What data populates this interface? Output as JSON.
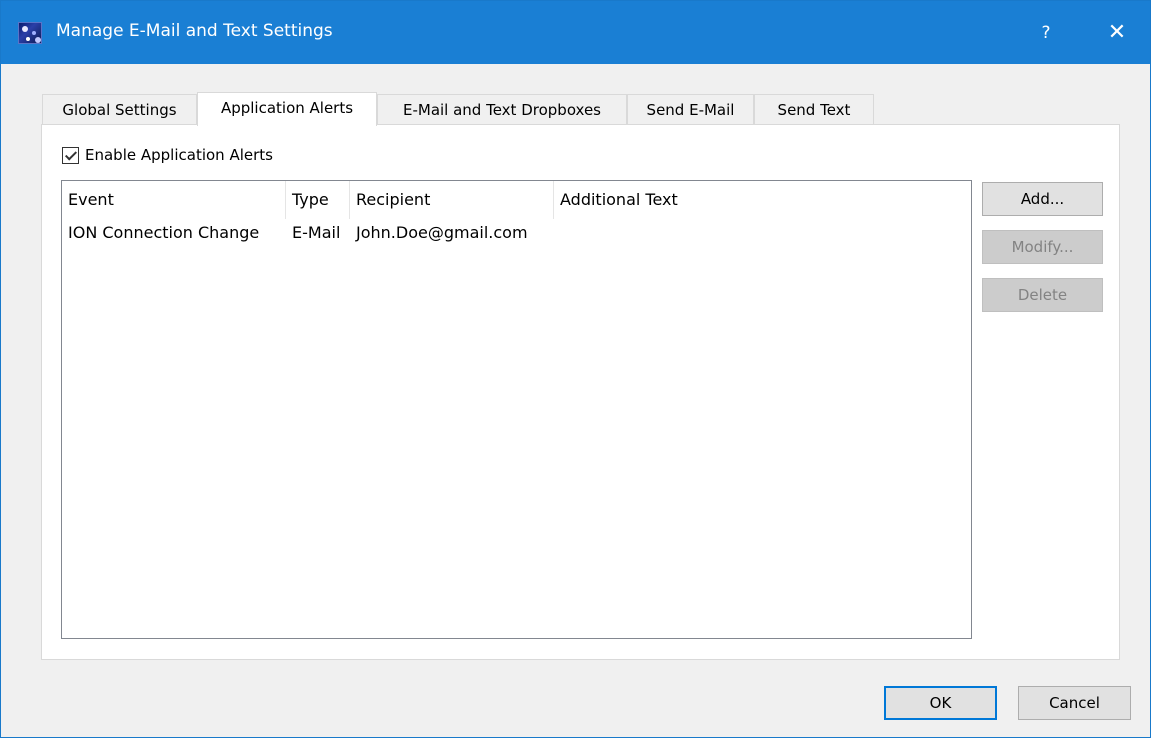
{
  "window": {
    "title": "Manage E-Mail and Text Settings",
    "help_glyph": "?",
    "close_glyph": "✕",
    "accent_color": "#1a7fd4",
    "app_icon": "app-logo-icon"
  },
  "tabs": [
    {
      "label": "Global Settings",
      "active": false
    },
    {
      "label": "Application Alerts",
      "active": true
    },
    {
      "label": "E-Mail and Text Dropboxes",
      "active": false
    },
    {
      "label": "Send E-Mail",
      "active": false
    },
    {
      "label": "Send Text",
      "active": false
    }
  ],
  "alerts": {
    "enable_label": "Enable Application Alerts",
    "enabled": true,
    "columns": [
      "Event",
      "Type",
      "Recipient",
      "Additional Text"
    ],
    "rows": [
      {
        "event": "ION Connection Change",
        "type": "E-Mail",
        "recipient": "John.Doe@gmail.com",
        "additional_text": ""
      }
    ]
  },
  "side_buttons": {
    "add": "Add...",
    "modify": "Modify...",
    "delete": "Delete"
  },
  "dialog_buttons": {
    "ok": "OK",
    "cancel": "Cancel"
  }
}
